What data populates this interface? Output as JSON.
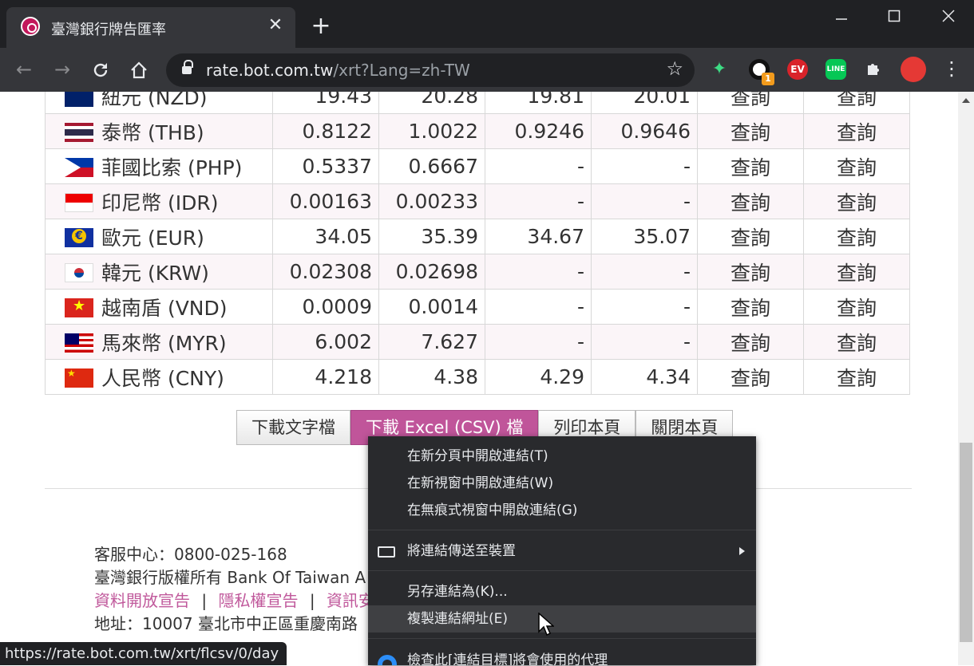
{
  "browser": {
    "tab_title": "臺灣銀行牌告匯率",
    "tab_close": "✕",
    "new_tab": "+",
    "url_host": "rate.bot.com.tw",
    "url_rest": "/xrt?Lang=zh-TW",
    "extension_badge": "1",
    "status_url": "https://rate.bot.com.tw/xrt/flcsv/0/day"
  },
  "rates": {
    "query_label": "查詢",
    "rows": [
      {
        "currency": "紐元 (NZD)",
        "flag": "nzd",
        "v1": "19.43",
        "v2": "20.28",
        "v3": "19.81",
        "v4": "20.01"
      },
      {
        "currency": "泰幣 (THB)",
        "flag": "thb",
        "v1": "0.8122",
        "v2": "1.0022",
        "v3": "0.9246",
        "v4": "0.9646"
      },
      {
        "currency": "菲國比索 (PHP)",
        "flag": "php",
        "v1": "0.5337",
        "v2": "0.6667",
        "v3": "-",
        "v4": "-"
      },
      {
        "currency": "印尼幣 (IDR)",
        "flag": "idr",
        "v1": "0.00163",
        "v2": "0.00233",
        "v3": "-",
        "v4": "-"
      },
      {
        "currency": "歐元 (EUR)",
        "flag": "eur",
        "v1": "34.05",
        "v2": "35.39",
        "v3": "34.67",
        "v4": "35.07"
      },
      {
        "currency": "韓元 (KRW)",
        "flag": "krw",
        "v1": "0.02308",
        "v2": "0.02698",
        "v3": "-",
        "v4": "-"
      },
      {
        "currency": "越南盾 (VND)",
        "flag": "vnd",
        "v1": "0.0009",
        "v2": "0.0014",
        "v3": "-",
        "v4": "-"
      },
      {
        "currency": "馬來幣 (MYR)",
        "flag": "myr",
        "v1": "6.002",
        "v2": "7.627",
        "v3": "-",
        "v4": "-"
      },
      {
        "currency": "人民幣 (CNY)",
        "flag": "cny",
        "v1": "4.218",
        "v2": "4.38",
        "v3": "4.29",
        "v4": "4.34"
      }
    ]
  },
  "buttons": {
    "download_text": "下載文字檔",
    "download_excel": "下載 Excel (CSV) 檔",
    "print": "列印本頁",
    "close": "關閉本頁"
  },
  "footer": {
    "service": "客服中心：0800-025-168",
    "copyright": "臺灣銀行版權所有 Bank Of Taiwan A",
    "open_data": "資料開放宣告",
    "privacy": "隱私權宣告",
    "info": "資訊安",
    "separator": "|",
    "address": "地址：10007 臺北市中正區重慶南路"
  },
  "context_menu": {
    "open_new_tab": "在新分頁中開啟連結(T)",
    "open_new_window": "在新視窗中開啟連結(W)",
    "open_incognito": "在無痕式視窗中開啟連結(G)",
    "send_to_device": "將連結傳送至裝置",
    "save_link_as": "另存連結為(K)...",
    "copy_link": "複製連結網址(E)",
    "inspect_proxy": "檢查此[連結目標]將會使用的代理"
  }
}
